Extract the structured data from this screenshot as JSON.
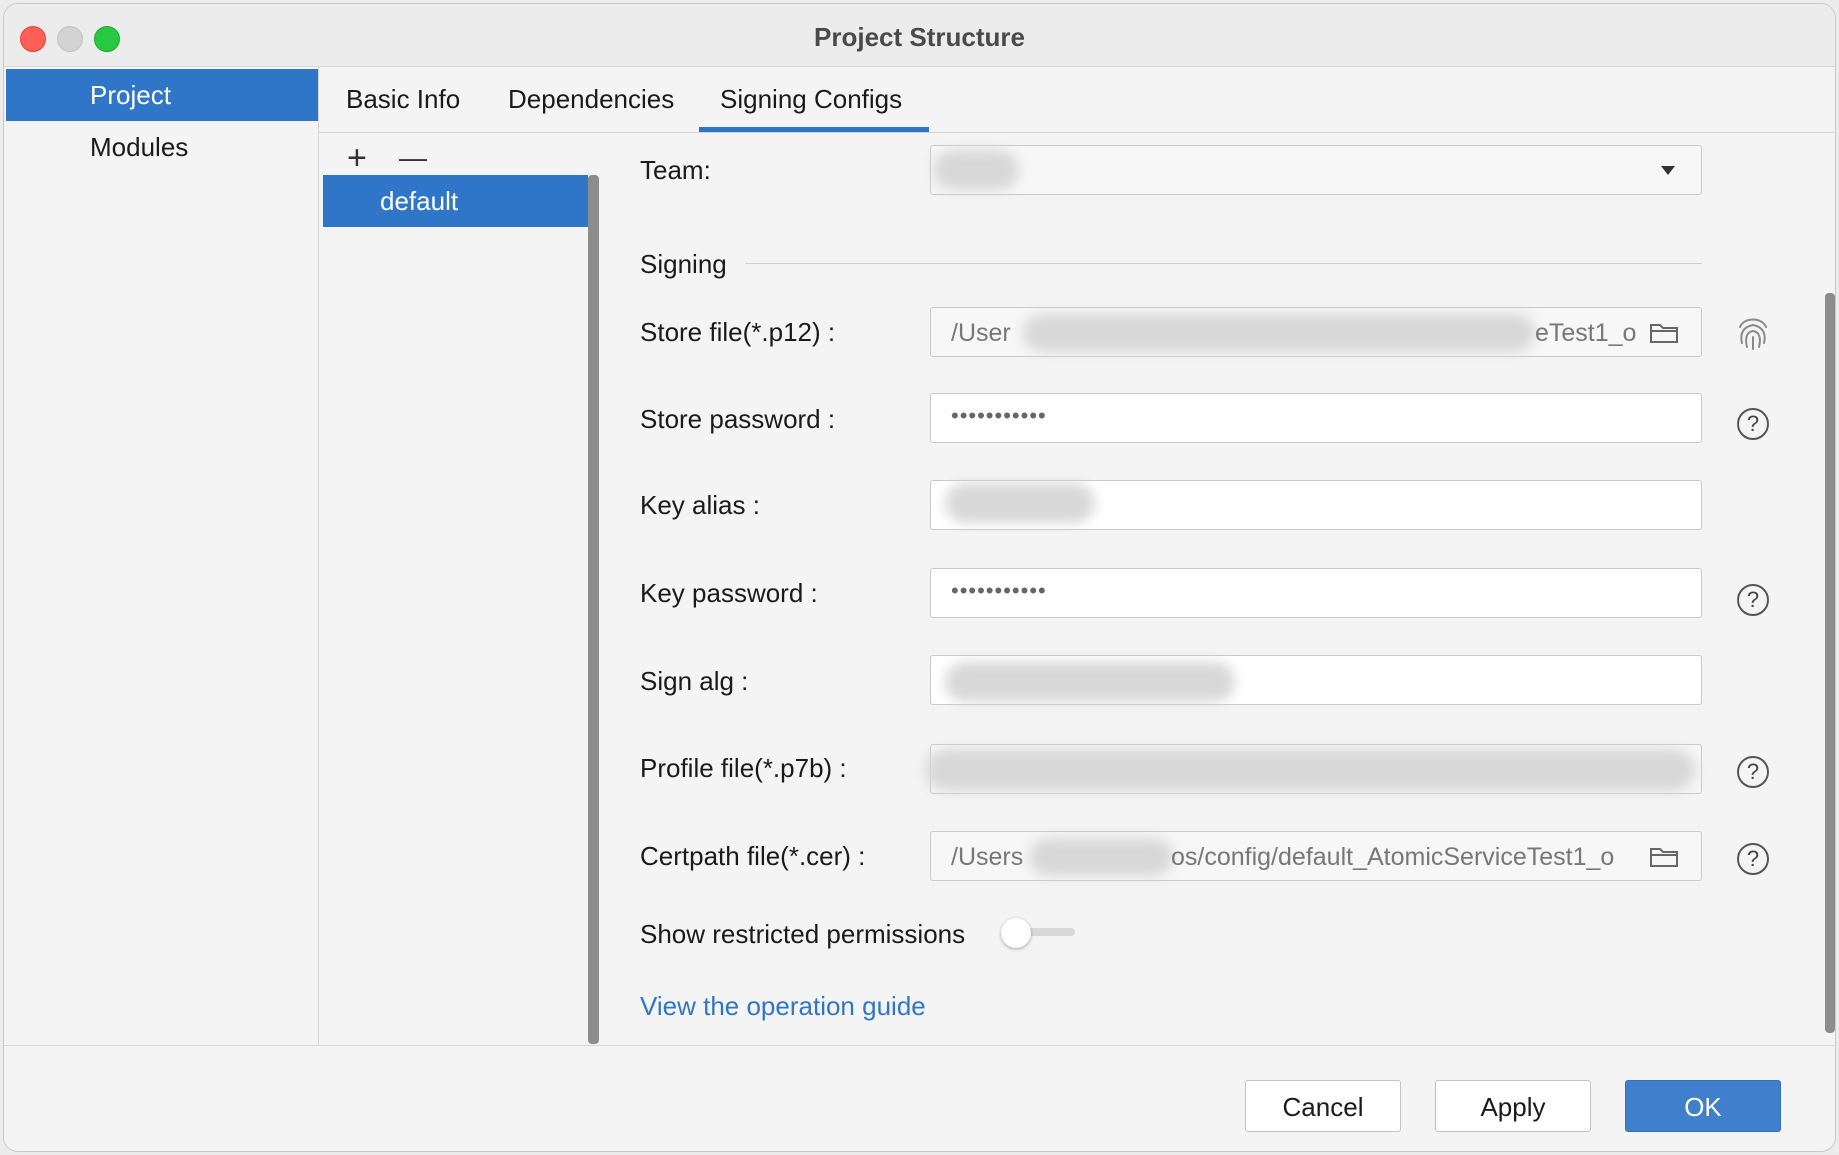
{
  "window": {
    "title": "Project Structure"
  },
  "nav": {
    "items": [
      {
        "label": "Project",
        "active": true
      },
      {
        "label": "Modules",
        "active": false
      }
    ]
  },
  "tabs": [
    {
      "label": "Basic Info"
    },
    {
      "label": "Dependencies"
    },
    {
      "label": "Signing Configs",
      "active": true
    }
  ],
  "configs": {
    "add_symbol": "+",
    "remove_symbol": "—",
    "items": [
      "default"
    ]
  },
  "form": {
    "team_label": "Team:",
    "signing_section": "Signing",
    "store_file_label": "Store file(*.p12) :",
    "store_file_value_start": "/User",
    "store_file_value_end": "eTest1_o",
    "store_password_label": "Store password :",
    "store_password_value": "•••••••••••",
    "key_alias_label": "Key alias :",
    "key_password_label": "Key password :",
    "key_password_value": "•••••••••••",
    "sign_alg_label": "Sign alg :",
    "profile_file_label": "Profile file(*.p7b) :",
    "certpath_file_label": "Certpath file(*.cer) :",
    "certpath_value_start": "/Users",
    "certpath_value_end": "os/config/default_AtomicServiceTest1_o",
    "restricted_label": "Show restricted permissions",
    "restricted_enabled": false,
    "guide_link": "View the operation guide",
    "help_symbol": "?"
  },
  "footer": {
    "cancel": "Cancel",
    "apply": "Apply",
    "ok": "OK"
  },
  "colors": {
    "accent": "#2f76c9",
    "link": "#2f76c9",
    "primary_button": "#3f7fcb"
  }
}
